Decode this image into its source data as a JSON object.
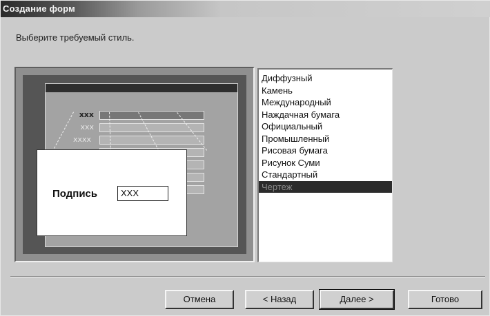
{
  "window": {
    "title": "Создание форм"
  },
  "instruction": "Выберите требуемый стиль.",
  "preview": {
    "field_labels": [
      "xxx",
      "xxx",
      "xxxx",
      "",
      "",
      "",
      ""
    ],
    "callout_label": "Подпись",
    "callout_value": "XXX"
  },
  "style_list": {
    "items": [
      "Диффузный",
      "Камень",
      "Международный",
      "Наждачная бумага",
      "Официальный",
      "Промышленный",
      "Рисовая бумага",
      "Рисунок Суми",
      "Стандартный",
      "Чертеж"
    ],
    "selected": "Чертеж"
  },
  "buttons": {
    "cancel": "Отмена",
    "back": "< Назад",
    "next": "Далее >",
    "finish": "Готово"
  }
}
